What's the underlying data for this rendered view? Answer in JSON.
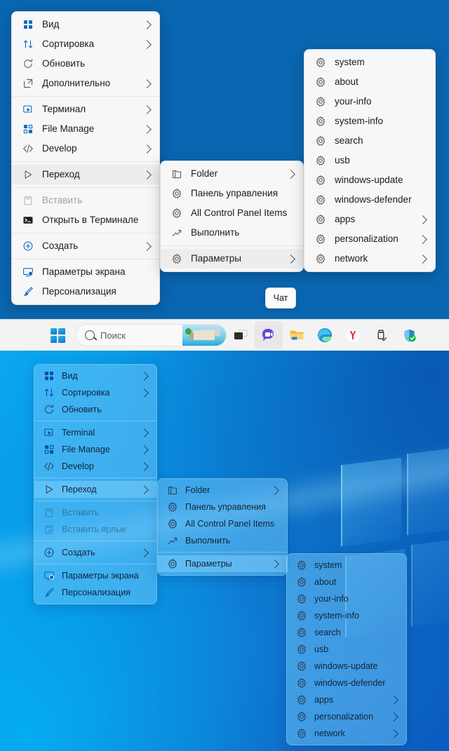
{
  "desktop": {
    "top_background_color": "#0a66b0",
    "bottom_background_color": "#0a8fe0"
  },
  "chat_button": {
    "label": "Чат"
  },
  "taskbar": {
    "start_label": "Start",
    "search": {
      "placeholder": "Поиск",
      "icon": "search-icon"
    },
    "icons": [
      {
        "name": "task-view-icon",
        "label": "Task View"
      },
      {
        "name": "chat-teams-icon",
        "label": "Chat"
      },
      {
        "name": "file-explorer-icon",
        "label": "Проводник"
      },
      {
        "name": "edge-browser-icon",
        "label": "Microsoft Edge"
      },
      {
        "name": "yandex-browser-icon",
        "label": "Yandex"
      },
      {
        "name": "usb-eject-icon",
        "label": "Safely Remove Hardware"
      },
      {
        "name": "windows-security-icon",
        "label": "Windows Security"
      }
    ]
  },
  "context_menu_root": {
    "items": [
      {
        "label": "Вид",
        "icon": "grid-view-icon",
        "chevron": true,
        "disabled": false,
        "highlight": false
      },
      {
        "label": "Сортировка",
        "icon": "sort-arrows-icon",
        "chevron": true,
        "disabled": false,
        "highlight": false
      },
      {
        "label": "Обновить",
        "icon": "refresh-icon",
        "chevron": false,
        "disabled": false,
        "highlight": false
      },
      {
        "label": "Дополнительно",
        "icon": "more-options-icon",
        "chevron": true,
        "disabled": false,
        "highlight": false
      },
      {
        "separator": true
      },
      {
        "label": "Терминал",
        "icon": "terminal-window-icon",
        "chevron": true,
        "disabled": false,
        "highlight": false
      },
      {
        "label": "File Manage",
        "icon": "grid-blocks-icon",
        "chevron": true,
        "disabled": false,
        "highlight": false
      },
      {
        "label": "Develop",
        "icon": "code-tags-icon",
        "chevron": true,
        "disabled": false,
        "highlight": false
      },
      {
        "separator": true
      },
      {
        "label": "Переход",
        "icon": "play-triangle-icon",
        "chevron": true,
        "disabled": false,
        "highlight": true
      },
      {
        "separator": true
      },
      {
        "label": "Вставить",
        "icon": "paste-icon",
        "chevron": false,
        "disabled": true,
        "highlight": false
      },
      {
        "label": "Открыть в Терминале",
        "icon": "console-icon",
        "chevron": false,
        "disabled": false,
        "highlight": false
      },
      {
        "separator": true
      },
      {
        "label": "Создать",
        "icon": "plus-circle-icon",
        "chevron": true,
        "disabled": false,
        "highlight": false
      },
      {
        "separator": true
      },
      {
        "label": "Параметры экрана",
        "icon": "display-settings-icon",
        "chevron": false,
        "disabled": false,
        "highlight": false
      },
      {
        "label": "Персонализация",
        "icon": "brush-icon",
        "chevron": false,
        "disabled": false,
        "highlight": false
      }
    ]
  },
  "context_menu_root_bottom": {
    "items": [
      {
        "label": "Вид",
        "icon": "grid-view-icon",
        "chevron": true,
        "disabled": false,
        "highlight": false
      },
      {
        "label": "Сортировка",
        "icon": "sort-arrows-icon",
        "chevron": true,
        "disabled": false,
        "highlight": false
      },
      {
        "label": "Обновить",
        "icon": "refresh-icon",
        "chevron": false,
        "disabled": false,
        "highlight": false
      },
      {
        "separator": true
      },
      {
        "label": "Terminal",
        "icon": "terminal-window-icon",
        "chevron": true,
        "disabled": false,
        "highlight": false
      },
      {
        "label": "File Manage",
        "icon": "grid-blocks-icon",
        "chevron": true,
        "disabled": false,
        "highlight": false
      },
      {
        "label": "Develop",
        "icon": "code-tags-icon",
        "chevron": true,
        "disabled": false,
        "highlight": false
      },
      {
        "separator": true
      },
      {
        "label": "Переход",
        "icon": "play-triangle-icon",
        "chevron": true,
        "disabled": false,
        "highlight": true
      },
      {
        "separator": true
      },
      {
        "label": "Вставить",
        "icon": "paste-icon",
        "chevron": false,
        "disabled": true,
        "highlight": false
      },
      {
        "label": "Вставить ярлык",
        "icon": "paste-shortcut-icon",
        "chevron": false,
        "disabled": true,
        "highlight": false
      },
      {
        "separator": true
      },
      {
        "label": "Создать",
        "icon": "plus-circle-icon",
        "chevron": true,
        "disabled": false,
        "highlight": false
      },
      {
        "separator": true
      },
      {
        "label": "Параметры экрана",
        "icon": "display-settings-icon",
        "chevron": false,
        "disabled": false,
        "highlight": false
      },
      {
        "label": "Персонализация",
        "icon": "brush-icon",
        "chevron": false,
        "disabled": false,
        "highlight": false
      }
    ]
  },
  "submenu_goto": {
    "items": [
      {
        "label": "Folder",
        "icon": "folder-outline-icon",
        "chevron": true,
        "highlight": false
      },
      {
        "label": "Панель управления",
        "icon": "gear-icon",
        "chevron": false,
        "highlight": false
      },
      {
        "label": "All Control Panel Items",
        "icon": "gear-icon",
        "chevron": false,
        "highlight": false
      },
      {
        "label": "Выполнить",
        "icon": "run-arrow-icon",
        "chevron": false,
        "highlight": false
      },
      {
        "separator": true
      },
      {
        "label": "Параметры",
        "icon": "gear-icon",
        "chevron": true,
        "highlight": true
      }
    ]
  },
  "submenu_settings": {
    "items": [
      {
        "label": "system",
        "icon": "gear-icon",
        "chevron": false
      },
      {
        "label": "about",
        "icon": "gear-icon",
        "chevron": false
      },
      {
        "label": "your-info",
        "icon": "gear-icon",
        "chevron": false
      },
      {
        "label": "system-info",
        "icon": "gear-icon",
        "chevron": false
      },
      {
        "label": "search",
        "icon": "gear-icon",
        "chevron": false
      },
      {
        "label": "usb",
        "icon": "gear-icon",
        "chevron": false
      },
      {
        "label": "windows-update",
        "icon": "gear-icon",
        "chevron": false
      },
      {
        "label": "windows-defender",
        "icon": "gear-icon",
        "chevron": false
      },
      {
        "label": "apps",
        "icon": "gear-icon",
        "chevron": true
      },
      {
        "label": "personalization",
        "icon": "gear-icon",
        "chevron": true
      },
      {
        "label": "network",
        "icon": "gear-icon",
        "chevron": true
      }
    ]
  }
}
